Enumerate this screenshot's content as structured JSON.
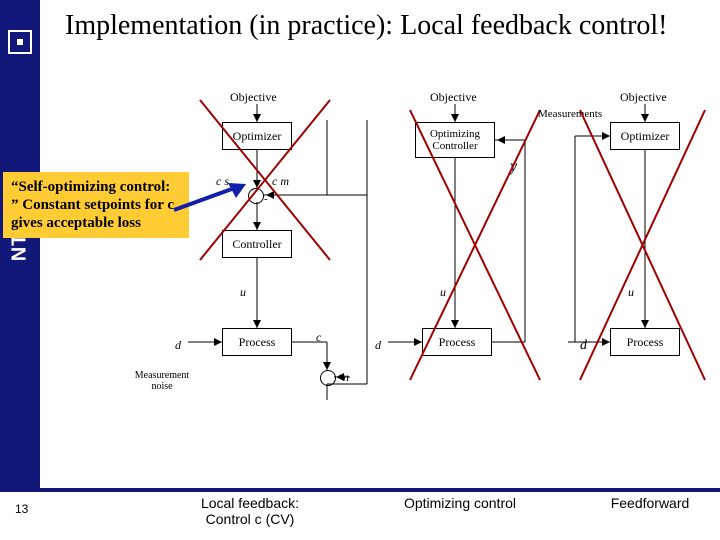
{
  "brand": "NTNU",
  "title": "Implementation (in practice): Local feedback control!",
  "page_number": "13",
  "callout": "“Self-optimizing control: ” Constant setpoints for c gives acceptable loss",
  "y_label": "y",
  "d_label": "d",
  "labels": {
    "objective": "Objective",
    "optimizer": "Optimizer",
    "controller": "Controller",
    "process": "Process",
    "optimizing_controller": "Optimizing Controller",
    "measurements": "Measurements",
    "meas_noise": "Measurement noise",
    "cs": "c s",
    "cm": "c m",
    "u": "u",
    "d": "d",
    "c": "c",
    "n": "n",
    "minus": "-"
  },
  "captions": {
    "col1": "Local feedback:\nControl c (CV)",
    "col2": "Optimizing control",
    "col3": "Feedforward"
  }
}
